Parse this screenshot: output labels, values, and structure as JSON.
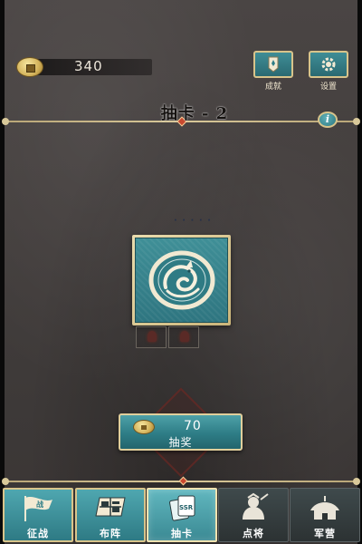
{
  "currency": {
    "value": "340",
    "icon": "coin-icon"
  },
  "top_buttons": [
    {
      "label": "成就",
      "icon": "banner-icon"
    },
    {
      "label": "设置",
      "icon": "gear-icon"
    }
  ],
  "header": {
    "title": "抽卡 - 2",
    "info_label": "i"
  },
  "scene": {
    "world_label": "· · · · ·"
  },
  "card": {
    "icon": "dragon-emblem-icon"
  },
  "draw_button": {
    "cost": "70",
    "label": "抽奖",
    "icon": "coin-icon"
  },
  "nav": [
    {
      "label": "征战",
      "icon": "war-flag-icon"
    },
    {
      "label": "布阵",
      "icon": "formation-flag-icon"
    },
    {
      "label": "抽卡",
      "icon": "ssr-card-icon",
      "badge": "SSR",
      "active": true
    },
    {
      "label": "点将",
      "icon": "general-icon"
    },
    {
      "label": "军营",
      "icon": "barracks-tent-icon"
    }
  ],
  "colors": {
    "teal": "#2e7d86",
    "gold_border": "#d8c48b",
    "accent_red": "#c9492f"
  }
}
